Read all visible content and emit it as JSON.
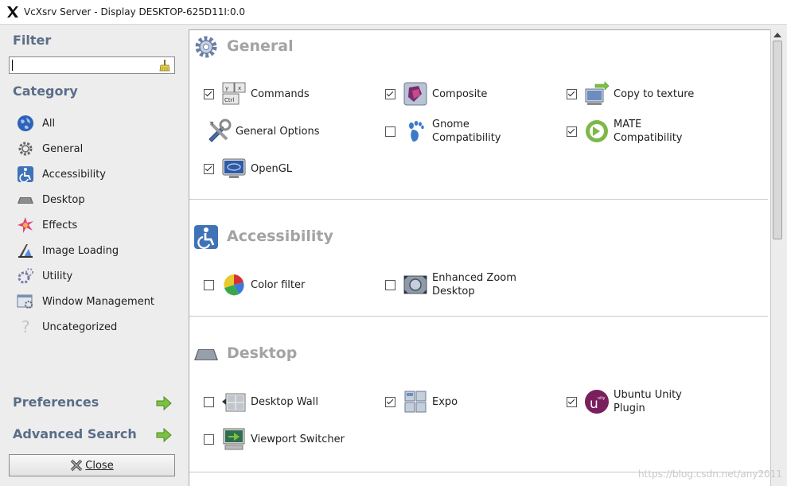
{
  "window": {
    "title": "VcXsrv Server - Display DESKTOP-625D11I:0.0"
  },
  "sidebar": {
    "filter_heading": "Filter",
    "filter_value": "",
    "category_heading": "Category",
    "categories": [
      {
        "label": "All",
        "icon": "globe-icon"
      },
      {
        "label": "General",
        "icon": "gear-icon"
      },
      {
        "label": "Accessibility",
        "icon": "accessibility-icon"
      },
      {
        "label": "Desktop",
        "icon": "desktop-icon"
      },
      {
        "label": "Effects",
        "icon": "effects-icon"
      },
      {
        "label": "Image Loading",
        "icon": "image-loading-icon"
      },
      {
        "label": "Utility",
        "icon": "utility-icon"
      },
      {
        "label": "Window Management",
        "icon": "window-management-icon"
      },
      {
        "label": "Uncategorized",
        "icon": "question-icon"
      }
    ],
    "preferences": "Preferences",
    "advanced_search": "Advanced Search",
    "close": "Close"
  },
  "sections": [
    {
      "title": "General",
      "plugins": [
        {
          "name": "Commands",
          "checked": true
        },
        {
          "name": "Composite",
          "checked": true
        },
        {
          "name": "Copy to texture",
          "checked": true
        },
        {
          "name": "General Options",
          "checked": null
        },
        {
          "name": "Gnome Compatibility",
          "checked": false
        },
        {
          "name": "MATE Compatibility",
          "checked": true
        },
        {
          "name": "OpenGL",
          "checked": true
        }
      ]
    },
    {
      "title": "Accessibility",
      "plugins": [
        {
          "name": "Color filter",
          "checked": false
        },
        {
          "name": "Enhanced Zoom Desktop",
          "checked": false
        }
      ]
    },
    {
      "title": "Desktop",
      "plugins": [
        {
          "name": "Desktop Wall",
          "checked": false
        },
        {
          "name": "Expo",
          "checked": true
        },
        {
          "name": "Ubuntu Unity Plugin",
          "checked": true
        },
        {
          "name": "Viewport Switcher",
          "checked": false
        }
      ]
    }
  ],
  "watermark": "https://blog.csdn.net/any2011"
}
